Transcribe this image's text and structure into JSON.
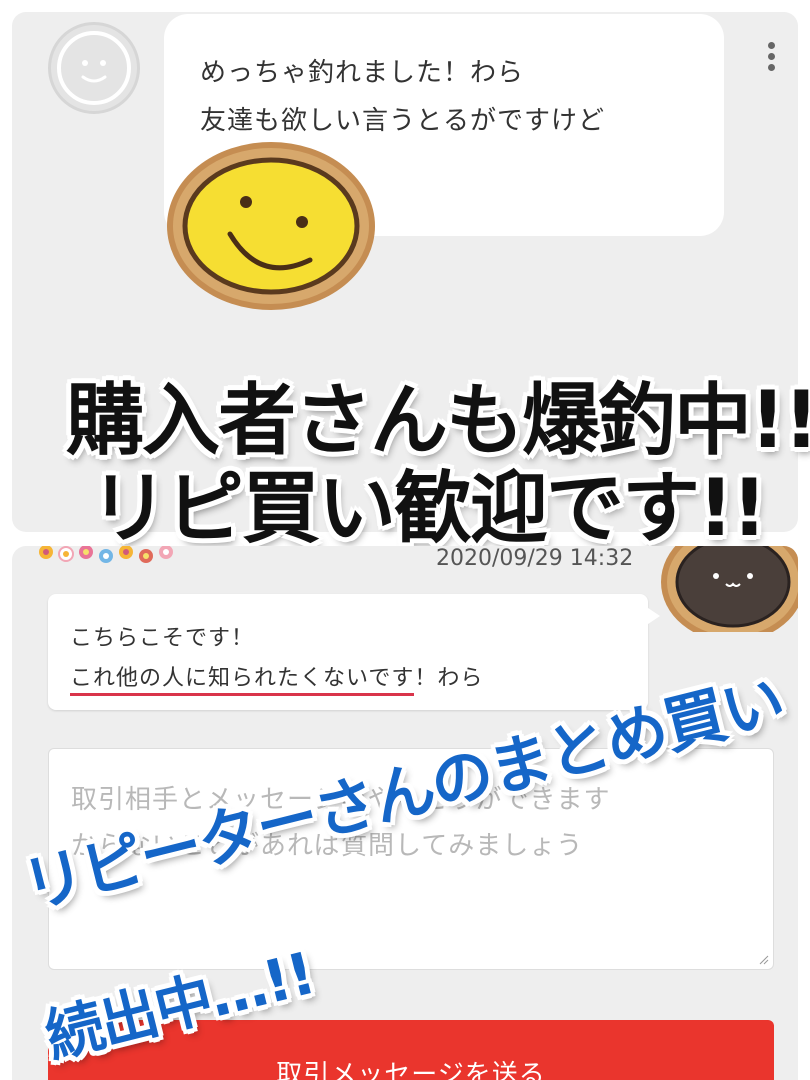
{
  "top_chat": {
    "message_lines": [
      "めっちゃ釣れました！わら",
      "友達も欲しい言うとるがですけど"
    ]
  },
  "promo_text": {
    "line1": "購入者さんも爆釣中!!",
    "line2": "リピ買い歓迎です!!",
    "blue_line1": "リピーターさんのまとめ買い",
    "blue_line2": "続出中…!!"
  },
  "bottom_chat": {
    "timestamp": "2020/09/29 14:32",
    "message_line1": "こちらこそです！",
    "message_line2_underlined": "これ他の人に知られたくないです",
    "message_line2_rest": "！わら"
  },
  "compose": {
    "placeholder_line1": "取引相手とメッセージのやりとりができます",
    "placeholder_line2": "からないことがあれば質問してみましょう",
    "send_label": "取引メッセージを送る"
  },
  "colors": {
    "accent_red": "#ea352d",
    "underline_red": "#d9344a",
    "overlay_blue": "#1566c8",
    "background_gray": "#eeeeee"
  },
  "icons": {
    "menu": "kebab-menu-icon",
    "user_avatar": "default-avatar-icon",
    "smiley": "smiley-face-sticker",
    "cat_avatar": "cat-avatar-icon",
    "flowers": "flower-decoration"
  }
}
